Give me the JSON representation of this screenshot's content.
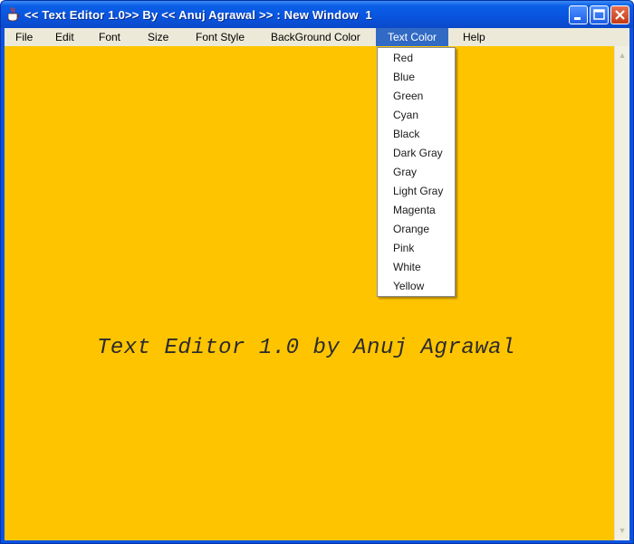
{
  "window": {
    "title": "<< Text Editor 1.0>> By << Anuj Agrawal >> : New Window  1"
  },
  "menubar": {
    "items": [
      "File",
      "Edit",
      "Font",
      "Size",
      "Font Style",
      "BackGround Color",
      "Text Color",
      "Help"
    ],
    "active": "Text Color"
  },
  "text_color_menu": {
    "options": [
      "Red",
      "Blue",
      "Green",
      "Cyan",
      "Black",
      "Dark Gray",
      "Gray",
      "Light Gray",
      "Magenta",
      "Orange",
      "Pink",
      "White",
      "Yellow"
    ]
  },
  "editor": {
    "content": "Text Editor 1.0 by Anuj Agrawal",
    "background_color": "#ffc400"
  },
  "icons": {
    "app_icon": "java-cup-icon",
    "minimize": "minimize-icon",
    "maximize": "maximize-icon",
    "close": "close-icon",
    "scroll_up": "scroll-up-arrow-icon",
    "scroll_down": "scroll-down-arrow-icon"
  },
  "colors": {
    "titlebar": "#0a5fe6",
    "menu_highlight": "#316ac5",
    "menubar": "#ece9d8"
  }
}
